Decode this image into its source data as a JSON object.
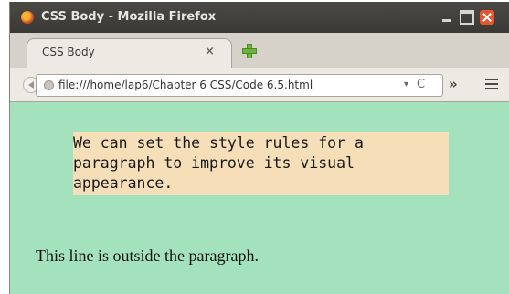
{
  "window": {
    "title": "CSS Body - Mozilla Firefox",
    "app_icon": "firefox-icon"
  },
  "tabs": [
    {
      "label": "CSS Body",
      "close": "×"
    }
  ],
  "navbar": {
    "url": "file:///home/lap6/Chapter 6 CSS/Code 6.5.html",
    "dropdown_glyph": "▾",
    "reload_glyph": "C",
    "overflow_glyph": "»"
  },
  "content": {
    "paragraph_lines": [
      "We can set the style rules for a",
      "paragraph to improve its visual",
      "appearance."
    ],
    "outside_text": "This line is outside the paragraph."
  },
  "colors": {
    "page_background": "#a3e2bc",
    "paragraph_background": "#f5deb8",
    "titlebar": "#3f3e3a",
    "close_button": "#e4572e"
  }
}
